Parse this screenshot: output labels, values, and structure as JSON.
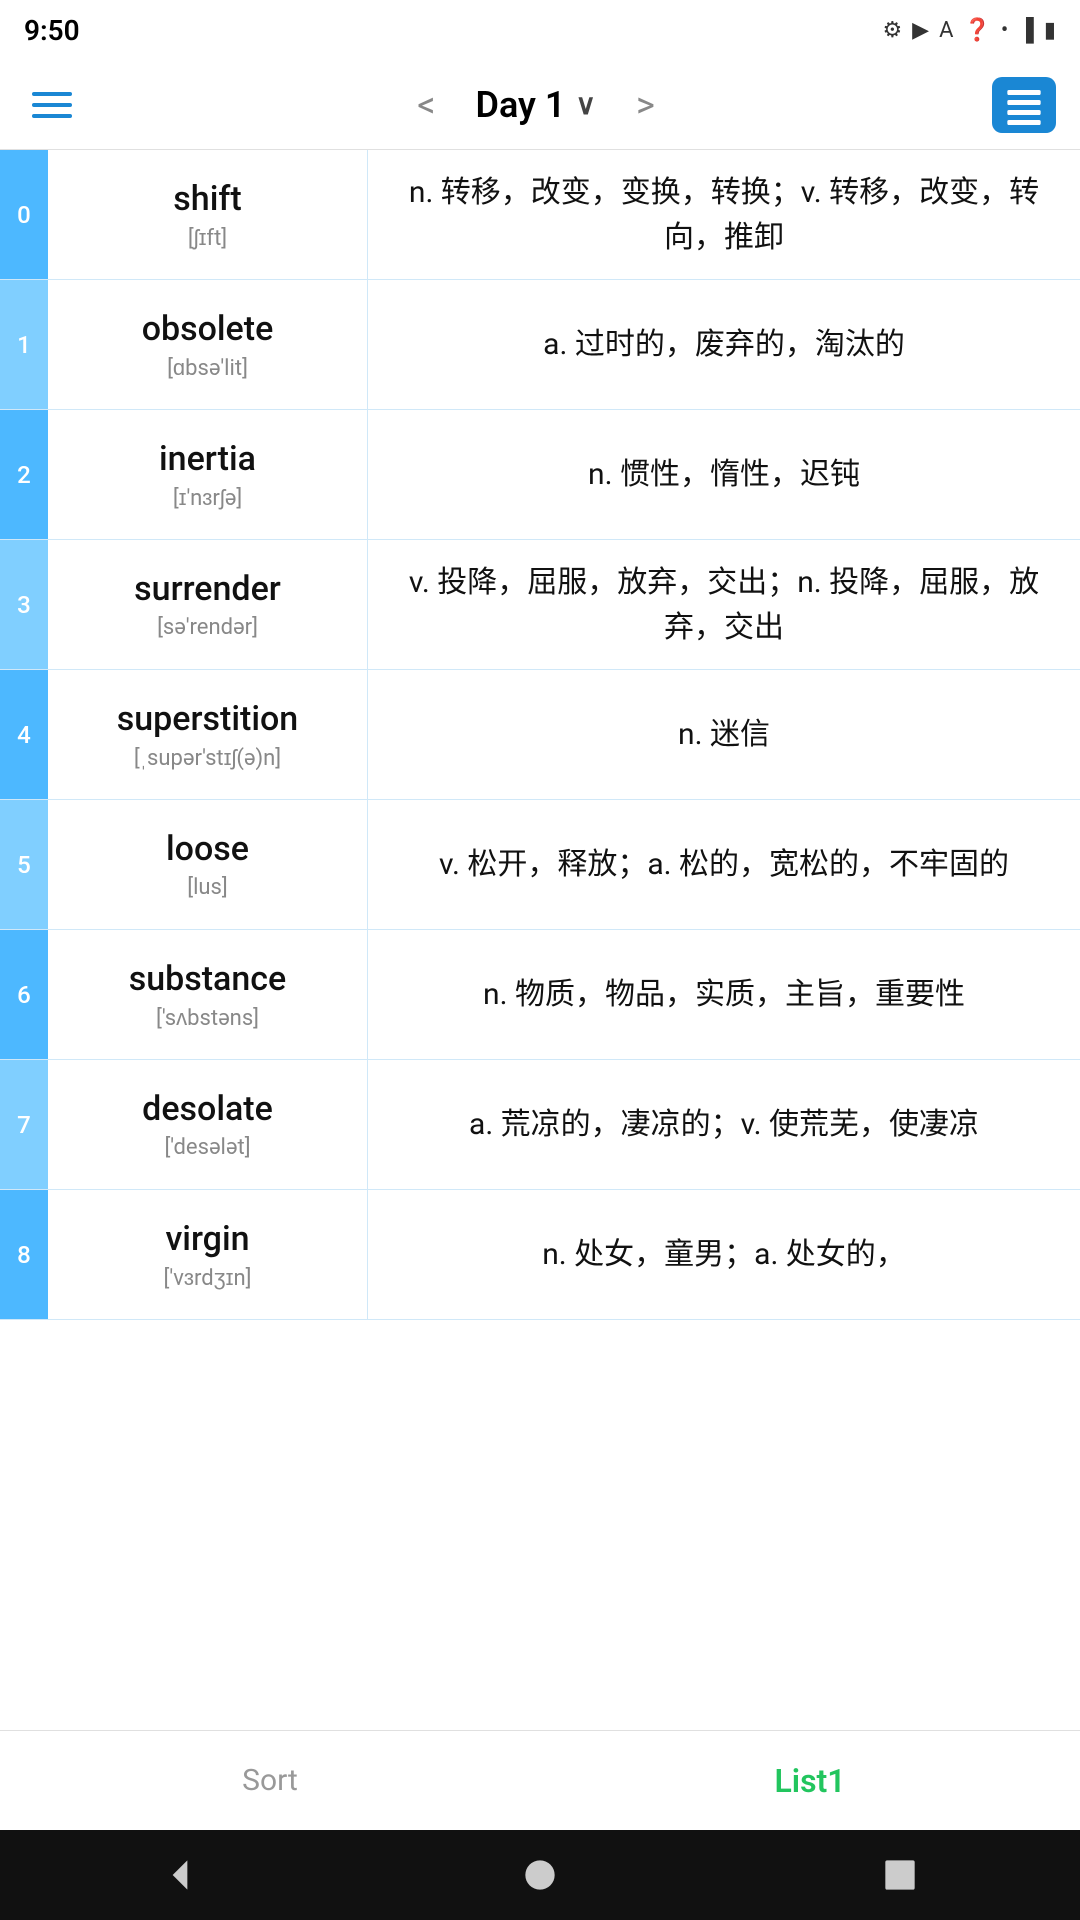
{
  "statusBar": {
    "time": "9:50",
    "icons": [
      "settings",
      "play",
      "font",
      "wifi",
      "signal",
      "battery"
    ]
  },
  "toolbar": {
    "menuLabel": "menu",
    "prevLabel": "<",
    "nextLabel": ">",
    "title": "Day 1",
    "titleChevron": "∨",
    "listViewLabel": "list-view"
  },
  "words": [
    {
      "index": "0",
      "english": "shift",
      "phonetic": "[ʃɪft]",
      "definition": "n. 转移，改变，变换，转换；v. 转移，改变，转向，推卸"
    },
    {
      "index": "1",
      "english": "obsolete",
      "phonetic": "[ɑbsə'lit]",
      "definition": "a. 过时的，废弃的，淘汰的"
    },
    {
      "index": "2",
      "english": "inertia",
      "phonetic": "[ɪ'nɜrʃə]",
      "definition": "n. 惯性，惰性，迟钝"
    },
    {
      "index": "3",
      "english": "surrender",
      "phonetic": "[sə'rendər]",
      "definition": "v. 投降，屈服，放弃，交出；n. 投降，屈服，放弃，交出"
    },
    {
      "index": "4",
      "english": "superstition",
      "phonetic": "[ˌsupər'stɪʃ(ə)n]",
      "definition": "n. 迷信"
    },
    {
      "index": "5",
      "english": "loose",
      "phonetic": "[lus]",
      "definition": "v. 松开，释放；a. 松的，宽松的，不牢固的"
    },
    {
      "index": "6",
      "english": "substance",
      "phonetic": "['sʌbstəns]",
      "definition": "n. 物质，物品，实质，主旨，重要性"
    },
    {
      "index": "7",
      "english": "desolate",
      "phonetic": "['desələt]",
      "definition": "a. 荒凉的，凄凉的；v. 使荒芜，使凄凉"
    },
    {
      "index": "8",
      "english": "virgin",
      "phonetic": "['vɜrdʒɪn]",
      "definition": "n. 处女，童男；a. 处女的，"
    }
  ],
  "bottomTabs": [
    {
      "id": "sort",
      "label": "Sort",
      "active": false
    },
    {
      "id": "list1",
      "label": "List1",
      "active": true
    }
  ],
  "navBar": {
    "backLabel": "◀",
    "homeLabel": "●",
    "recentLabel": "■"
  }
}
